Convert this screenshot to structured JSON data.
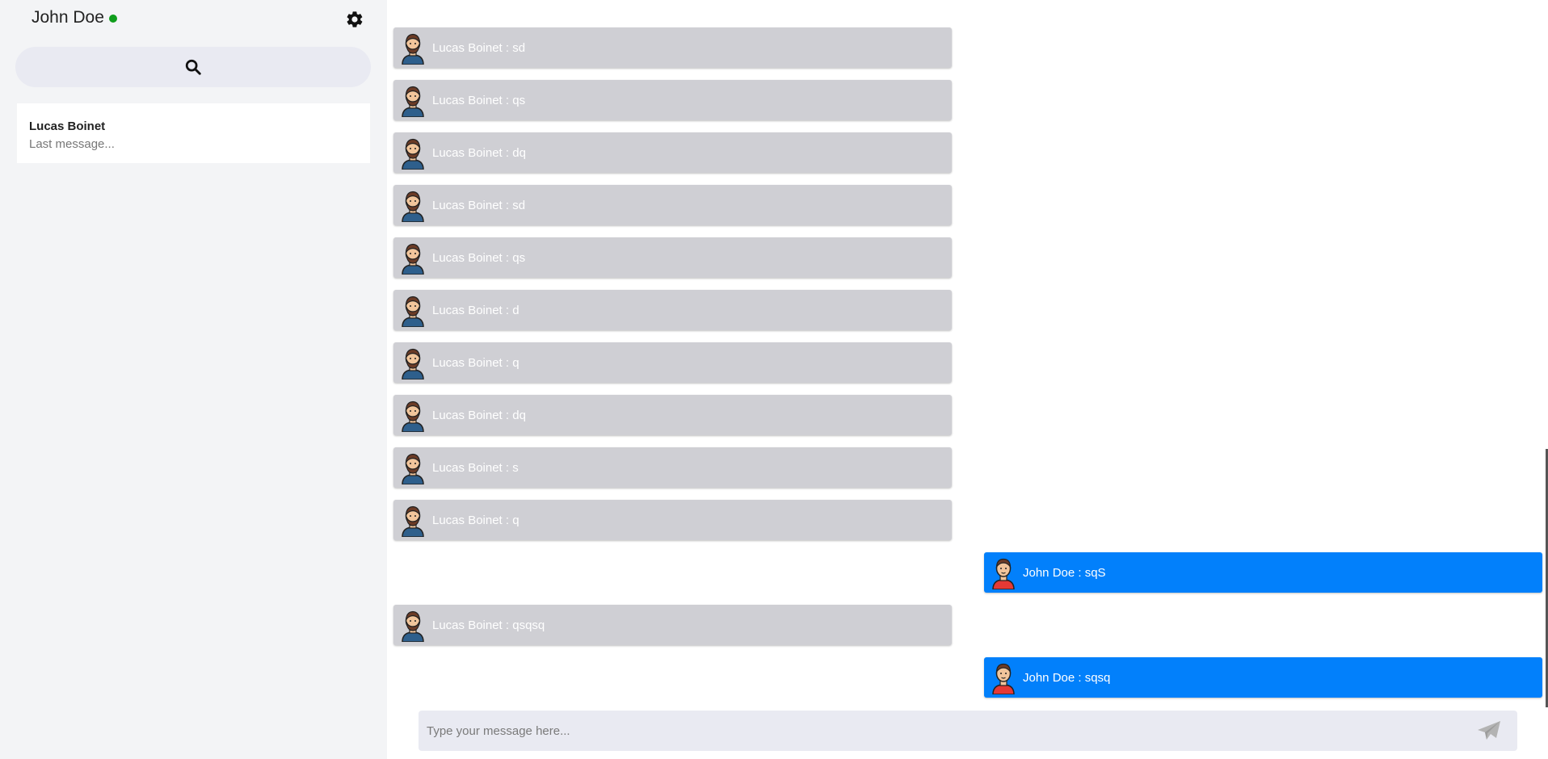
{
  "sidebar": {
    "user_name": "John Doe",
    "status_color": "#0f9d1c",
    "settings_icon": "gear-icon",
    "search_icon": "search-icon",
    "contacts": [
      {
        "name": "Lucas Boinet",
        "last_message": "Last message..."
      }
    ]
  },
  "chat": {
    "messages": [
      {
        "sender": "Lucas Boinet",
        "text": "Lucas Boinet : sd",
        "direction": "in"
      },
      {
        "sender": "Lucas Boinet",
        "text": "Lucas Boinet : qs",
        "direction": "in"
      },
      {
        "sender": "Lucas Boinet",
        "text": "Lucas Boinet : dq",
        "direction": "in"
      },
      {
        "sender": "Lucas Boinet",
        "text": "Lucas Boinet : sd",
        "direction": "in"
      },
      {
        "sender": "Lucas Boinet",
        "text": "Lucas Boinet : qs",
        "direction": "in"
      },
      {
        "sender": "Lucas Boinet",
        "text": "Lucas Boinet : d",
        "direction": "in"
      },
      {
        "sender": "Lucas Boinet",
        "text": "Lucas Boinet : q",
        "direction": "in"
      },
      {
        "sender": "Lucas Boinet",
        "text": "Lucas Boinet : dq",
        "direction": "in"
      },
      {
        "sender": "Lucas Boinet",
        "text": "Lucas Boinet : s",
        "direction": "in"
      },
      {
        "sender": "Lucas Boinet",
        "text": "Lucas Boinet : q",
        "direction": "in"
      },
      {
        "sender": "John Doe",
        "text": "John Doe : sqS",
        "direction": "out"
      },
      {
        "sender": "Lucas Boinet",
        "text": "Lucas Boinet : qsqsq",
        "direction": "in"
      },
      {
        "sender": "John Doe",
        "text": "John Doe : sqsq",
        "direction": "out"
      }
    ],
    "incoming_color": "#cfcfd4",
    "outgoing_color": "#0280fb"
  },
  "composer": {
    "placeholder": "Type your message here...",
    "value": "",
    "send_icon": "paper-plane-icon"
  }
}
